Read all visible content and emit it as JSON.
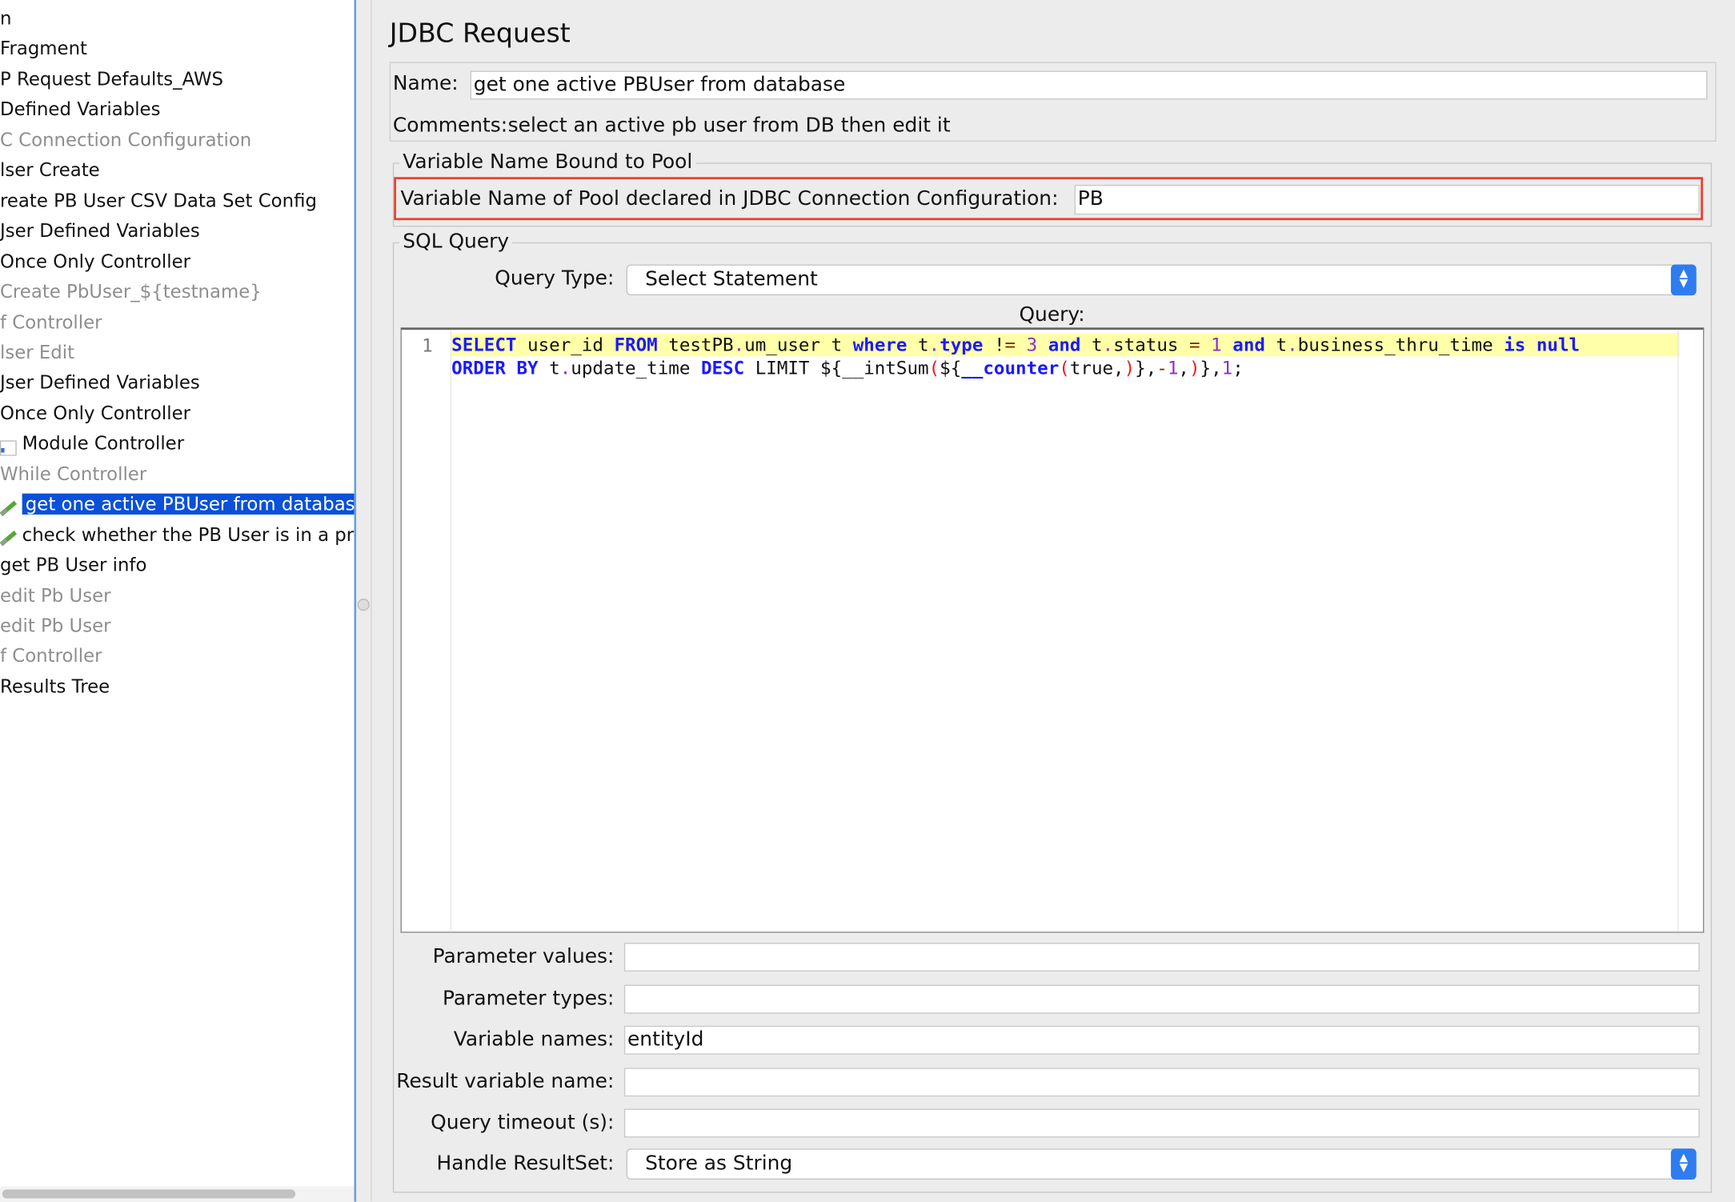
{
  "tree": {
    "items": [
      {
        "label": "n",
        "disabled": false
      },
      {
        "label": " Fragment",
        "disabled": false
      },
      {
        "label": "P Request Defaults_AWS",
        "disabled": false
      },
      {
        "label": " Defined Variables",
        "disabled": false
      },
      {
        "label": "C Connection Configuration",
        "disabled": true
      },
      {
        "label": "lser Create",
        "disabled": false
      },
      {
        "label": "reate PB User CSV Data Set Config",
        "disabled": false
      },
      {
        "label": "Jser Defined Variables",
        "disabled": false
      },
      {
        "label": "Once Only Controller",
        "disabled": false
      },
      {
        "label": "Create PbUser_${testname}",
        "disabled": true
      },
      {
        "label": "f Controller",
        "disabled": true
      },
      {
        "label": "lser Edit",
        "disabled": true
      },
      {
        "label": "Jser Defined Variables",
        "disabled": false
      },
      {
        "label": "Once Only Controller",
        "disabled": false
      },
      {
        "label": "Module Controller",
        "disabled": false,
        "icon": "module-controller-icon"
      },
      {
        "label": "While Controller",
        "disabled": true
      },
      {
        "label": "get one active PBUser from databas",
        "disabled": false,
        "selected": true,
        "icon": "jdbc-sampler-icon"
      },
      {
        "label": "check whether the PB User is in a pr",
        "disabled": false,
        "icon": "jdbc-sampler-icon"
      },
      {
        "label": "get PB User info",
        "disabled": false
      },
      {
        "label": "edit Pb User",
        "disabled": true
      },
      {
        "label": "edit Pb User",
        "disabled": true
      },
      {
        "label": "f Controller",
        "disabled": true
      },
      {
        "label": " Results Tree",
        "disabled": false
      }
    ]
  },
  "panel": {
    "title": "JDBC Request",
    "name_label": "Name:",
    "name_value": "get one active PBUser from database",
    "comments_label": "Comments:",
    "comments_value": "select an active pb user from DB then edit it",
    "pool_legend": "Variable Name Bound to Pool",
    "pool_label": "Variable Name of Pool declared in JDBC Connection Configuration:",
    "pool_value": "PB",
    "sql_legend": "SQL Query",
    "query_type_label": "Query Type:",
    "query_type_value": "Select Statement",
    "query_label": "Query:",
    "line_numbers": [
      "1"
    ],
    "query_text": "SELECT user_id FROM testPB.um_user t where t.type != 3 and t.status = 1 and t.business_thru_time is null\nORDER BY t.update_time DESC LIMIT ${__intSum(${__counter(true,)},-1,)},1;",
    "params": [
      {
        "label": "Parameter values:",
        "value": ""
      },
      {
        "label": "Parameter types:",
        "value": ""
      },
      {
        "label": "Variable names:",
        "value": "entityId"
      },
      {
        "label": "Result variable name:",
        "value": ""
      },
      {
        "label": "Query timeout (s):",
        "value": ""
      }
    ],
    "resultset_label": "Handle ResultSet:",
    "resultset_value": "Store as String"
  },
  "colors": {
    "selection": "#0a50d8",
    "highlight_box": "#e8432f",
    "current_line": "#ffffaa",
    "keyword": "#1a1aff"
  }
}
